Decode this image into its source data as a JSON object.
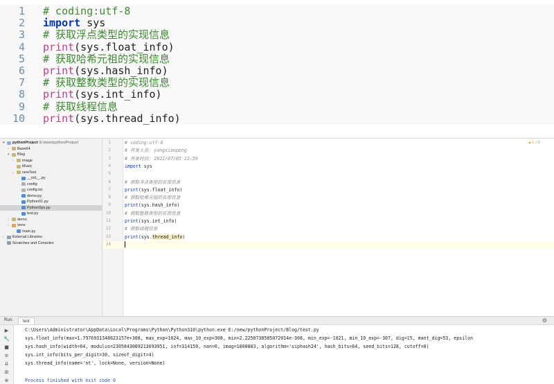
{
  "snippet": {
    "lines": [
      {
        "n": "1",
        "parts": [
          {
            "t": "# coding:utf-8",
            "c": "cm"
          }
        ]
      },
      {
        "n": "2",
        "parts": [
          {
            "t": "import",
            "c": "kw"
          },
          {
            "t": " sys",
            "c": ""
          }
        ]
      },
      {
        "n": "3",
        "parts": [
          {
            "t": "# 获取浮点类型的实现信息",
            "c": "cm"
          }
        ]
      },
      {
        "n": "4",
        "parts": [
          {
            "t": "print",
            "c": "fn"
          },
          {
            "t": "(sys.float_info)",
            "c": ""
          }
        ]
      },
      {
        "n": "5",
        "parts": [
          {
            "t": "# 获取哈希元祖的实现信息",
            "c": "cm"
          }
        ]
      },
      {
        "n": "6",
        "parts": [
          {
            "t": "print",
            "c": "fn"
          },
          {
            "t": "(sys.hash_info)",
            "c": ""
          }
        ]
      },
      {
        "n": "7",
        "parts": [
          {
            "t": "# 获取整数类型的实现信息",
            "c": "cm"
          }
        ]
      },
      {
        "n": "8",
        "parts": [
          {
            "t": "print",
            "c": "fn"
          },
          {
            "t": "(sys.int_info)",
            "c": ""
          }
        ]
      },
      {
        "n": "9",
        "parts": [
          {
            "t": "# 获取线程信息",
            "c": "cm"
          }
        ]
      },
      {
        "n": "10",
        "parts": [
          {
            "t": "print",
            "c": "fn"
          },
          {
            "t": "(sys.thread_info)",
            "c": ""
          }
        ]
      }
    ]
  },
  "project": {
    "items": [
      {
        "label": "pythonProject",
        "path": "E:\\new\\pythonProject",
        "indent": 0,
        "arrow": "▾",
        "icon": "folder-blue",
        "bold": true
      },
      {
        "label": "Base64",
        "indent": 1,
        "arrow": "›",
        "icon": "folder"
      },
      {
        "label": "Blog",
        "indent": 1,
        "arrow": "▾",
        "icon": "folder"
      },
      {
        "label": "image",
        "indent": 2,
        "arrow": "›",
        "icon": "folder"
      },
      {
        "label": "Music",
        "indent": 2,
        "arrow": "",
        "icon": "folder"
      },
      {
        "label": "newTest",
        "indent": 2,
        "arrow": "›",
        "icon": "folder"
      },
      {
        "label": "__init__.py",
        "indent": 3,
        "arrow": "",
        "icon": "py"
      },
      {
        "label": "config",
        "indent": 3,
        "arrow": "",
        "icon": "txt"
      },
      {
        "label": "config.txt",
        "indent": 3,
        "arrow": "",
        "icon": "txt"
      },
      {
        "label": "demo.py",
        "indent": 3,
        "arrow": "",
        "icon": "py"
      },
      {
        "label": "Python01.py",
        "indent": 3,
        "arrow": "",
        "icon": "py"
      },
      {
        "label": "PythonSys.py",
        "indent": 3,
        "arrow": "",
        "icon": "py",
        "selected": true
      },
      {
        "label": "test.py",
        "indent": 3,
        "arrow": "",
        "icon": "py"
      },
      {
        "label": "demo",
        "indent": 1,
        "arrow": "›",
        "icon": "folder"
      },
      {
        "label": "venv",
        "indent": 1,
        "arrow": "›",
        "icon": "folder-orange"
      },
      {
        "label": "main.py",
        "indent": 2,
        "arrow": "",
        "icon": "py"
      },
      {
        "label": "External Libraries",
        "indent": 0,
        "arrow": "›",
        "icon": "lib"
      },
      {
        "label": "Scratches and Consoles",
        "indent": 0,
        "arrow": "",
        "icon": "lib"
      }
    ]
  },
  "editor": {
    "status_warn": "▲1",
    "status_ok": "✓2",
    "lines": [
      {
        "n": "1",
        "parts": [
          {
            "t": "# coding:utf-8",
            "c": "cm"
          }
        ]
      },
      {
        "n": "2",
        "parts": [
          {
            "t": "# 开发人员: yangxiaopeng",
            "c": "cm"
          }
        ]
      },
      {
        "n": "3",
        "parts": [
          {
            "t": "# 开发时间: 2022/07/05 22:59",
            "c": "cm"
          }
        ]
      },
      {
        "n": "4",
        "parts": [
          {
            "t": "import",
            "c": "kw"
          },
          {
            "t": " sys",
            "c": ""
          }
        ]
      },
      {
        "n": "5",
        "parts": []
      },
      {
        "n": "6",
        "parts": [
          {
            "t": "# 获取浮点类型的实现信息",
            "c": "cm"
          }
        ]
      },
      {
        "n": "7",
        "parts": [
          {
            "t": "print",
            "c": "fn"
          },
          {
            "t": "(sys.float_info)",
            "c": ""
          }
        ]
      },
      {
        "n": "8",
        "parts": [
          {
            "t": "# 获取哈希元祖的实现信息",
            "c": "cm"
          }
        ]
      },
      {
        "n": "9",
        "parts": [
          {
            "t": "print",
            "c": "fn"
          },
          {
            "t": "(sys.hash_info)",
            "c": ""
          }
        ]
      },
      {
        "n": "10",
        "parts": [
          {
            "t": "# 获取整数类型的实现信息",
            "c": "cm"
          }
        ]
      },
      {
        "n": "11",
        "parts": [
          {
            "t": "print",
            "c": "fn"
          },
          {
            "t": "(sys.int_info)",
            "c": ""
          }
        ]
      },
      {
        "n": "12",
        "parts": [
          {
            "t": "# 获取线程信息",
            "c": "cm"
          }
        ]
      },
      {
        "n": "13",
        "parts": [
          {
            "t": "print",
            "c": "fn"
          },
          {
            "t": "(sys.",
            "c": ""
          },
          {
            "t": "thread_info",
            "c": "hl"
          },
          {
            "t": ")",
            "c": ""
          }
        ]
      },
      {
        "n": "14",
        "parts": [],
        "current": true
      }
    ]
  },
  "run": {
    "label": "Run:",
    "tab": "test",
    "gear": "⚙",
    "toolbar": [
      "▶",
      "🔧",
      "■",
      "≡",
      "⇊",
      "⊞",
      "⊗"
    ],
    "console": [
      {
        "t": "C:\\Users\\Administrator\\AppData\\Local\\Programs\\Python\\Python310\\python.exe E:/new/pythonProject/Blog/test.py",
        "c": "cmd"
      },
      {
        "t": "sys.float_info(max=1.7976931348623157e+308, max_exp=1024, max_10_exp=308, min=2.2250738585072014e-308, min_exp=-1021, min_10_exp=-307, dig=15, mant_dig=53, epsilon",
        "c": ""
      },
      {
        "t": "sys.hash_info(width=64, modulus=2305843009213693951, inf=314159, nan=0, imag=1000003, algorithm='siphash24', hash_bits=64, seed_bits=128, cutoff=0)",
        "c": ""
      },
      {
        "t": "sys.int_info(bits_per_digit=30, sizeof_digit=4)",
        "c": ""
      },
      {
        "t": "sys.thread_info(name='nt', lock=None, version=None)",
        "c": ""
      },
      {
        "t": "",
        "c": ""
      },
      {
        "t": "Process finished with exit code 0",
        "c": "done"
      }
    ]
  }
}
